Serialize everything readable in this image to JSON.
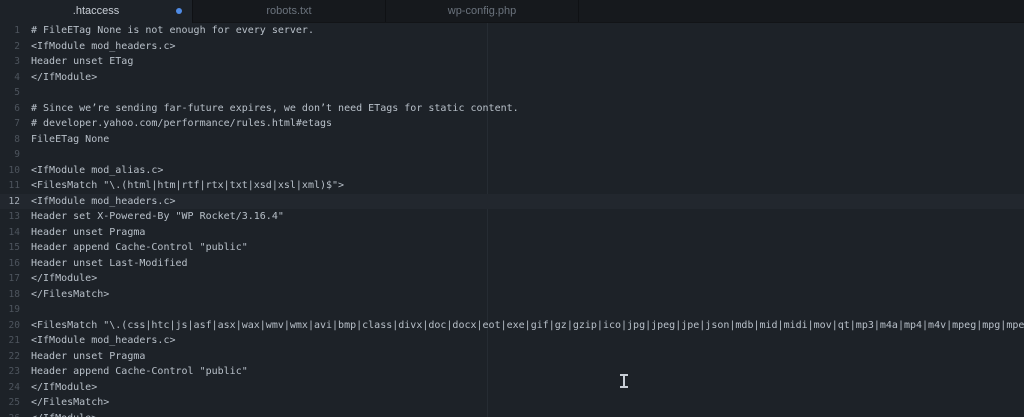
{
  "colors": {
    "modified_dot": "#4f8be5"
  },
  "tabs": [
    {
      "label": ".htaccess",
      "active": true,
      "modified": true
    },
    {
      "label": "robots.txt",
      "active": false,
      "modified": false
    },
    {
      "label": "wp-config.php",
      "active": false,
      "modified": false
    }
  ],
  "editor": {
    "current_line": 12,
    "lines": [
      {
        "num": "1",
        "text": "# FileETag None is not enough for every server."
      },
      {
        "num": "2",
        "text": "<IfModule mod_headers.c>"
      },
      {
        "num": "3",
        "text": "Header unset ETag"
      },
      {
        "num": "4",
        "text": "</IfModule>"
      },
      {
        "num": "5",
        "text": ""
      },
      {
        "num": "6",
        "text": "# Since we’re sending far-future expires, we don’t need ETags for static content."
      },
      {
        "num": "7",
        "text": "# developer.yahoo.com/performance/rules.html#etags"
      },
      {
        "num": "8",
        "text": "FileETag None"
      },
      {
        "num": "9",
        "text": ""
      },
      {
        "num": "10",
        "text": "<IfModule mod_alias.c>"
      },
      {
        "num": "11",
        "text": "<FilesMatch \"\\.(html|htm|rtf|rtx|txt|xsd|xsl|xml)$\">"
      },
      {
        "num": "12",
        "text": "<IfModule mod_headers.c>"
      },
      {
        "num": "13",
        "text": "Header set X-Powered-By \"WP Rocket/3.16.4\""
      },
      {
        "num": "14",
        "text": "Header unset Pragma"
      },
      {
        "num": "15",
        "text": "Header append Cache-Control \"public\""
      },
      {
        "num": "16",
        "text": "Header unset Last-Modified"
      },
      {
        "num": "17",
        "text": "</IfModule>"
      },
      {
        "num": "18",
        "text": "</FilesMatch>"
      },
      {
        "num": "19",
        "text": ""
      },
      {
        "num": "20",
        "text": "<FilesMatch \"\\.(css|htc|js|asf|asx|wax|wmv|wmx|avi|bmp|class|divx|doc|docx|eot|exe|gif|gz|gzip|ico|jpg|jpeg|jpe|json|mdb|mid|midi|mov|qt|mp3|m4a|mp4|m4v|mpeg|mpg|mpe|mpp|otf|o"
      },
      {
        "num": "21",
        "text": "<IfModule mod_headers.c>"
      },
      {
        "num": "22",
        "text": "Header unset Pragma"
      },
      {
        "num": "23",
        "text": "Header append Cache-Control \"public\""
      },
      {
        "num": "24",
        "text": "</IfModule>"
      },
      {
        "num": "25",
        "text": "</FilesMatch>"
      },
      {
        "num": "26",
        "text": "</IfModule>"
      }
    ]
  }
}
